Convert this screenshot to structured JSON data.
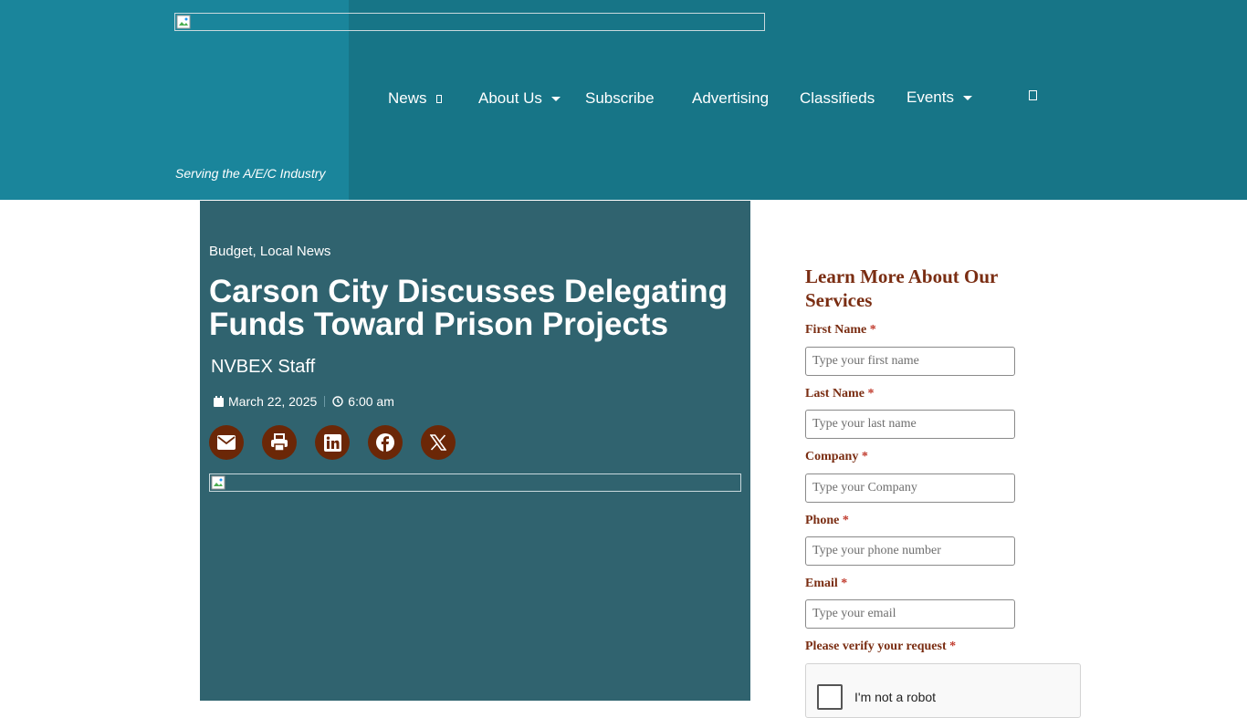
{
  "header": {
    "tagline": "Serving the A/E/C Industry",
    "nav": [
      {
        "label": "News"
      },
      {
        "label": "About Us"
      },
      {
        "label": "Subscribe"
      },
      {
        "label": "Advertising"
      },
      {
        "label": "Classifieds"
      },
      {
        "label": "Events"
      }
    ]
  },
  "article": {
    "categories": [
      "Budget",
      "Local News"
    ],
    "category_separator": ", ",
    "title": "Carson City Discusses Delegating Funds Toward Prison Projects",
    "author": "NVBEX Staff",
    "date": "March 22, 2025",
    "time": "6:00 am",
    "share_icons": [
      "envelope-icon",
      "print-icon",
      "linkedin-icon",
      "facebook-icon",
      "x-icon"
    ]
  },
  "form": {
    "title": "Learn More About Our Services",
    "required_mark": "*",
    "fields": [
      {
        "label": "First Name",
        "placeholder": "Type your first name"
      },
      {
        "label": "Last Name",
        "placeholder": "Type your last name"
      },
      {
        "label": "Company",
        "placeholder": "Type your Company"
      },
      {
        "label": "Phone",
        "placeholder": "Type your phone number"
      },
      {
        "label": "Email",
        "placeholder": "Type your email"
      }
    ],
    "verify_label": "Please verify your request",
    "recaptcha_label": "I'm not a robot"
  },
  "colors": {
    "header_bg": "#177587",
    "logo_panel_bg": "#1a859b",
    "article_bg": "#30636f",
    "share_button_bg": "#6b2707",
    "form_accent": "#7a2d12"
  }
}
